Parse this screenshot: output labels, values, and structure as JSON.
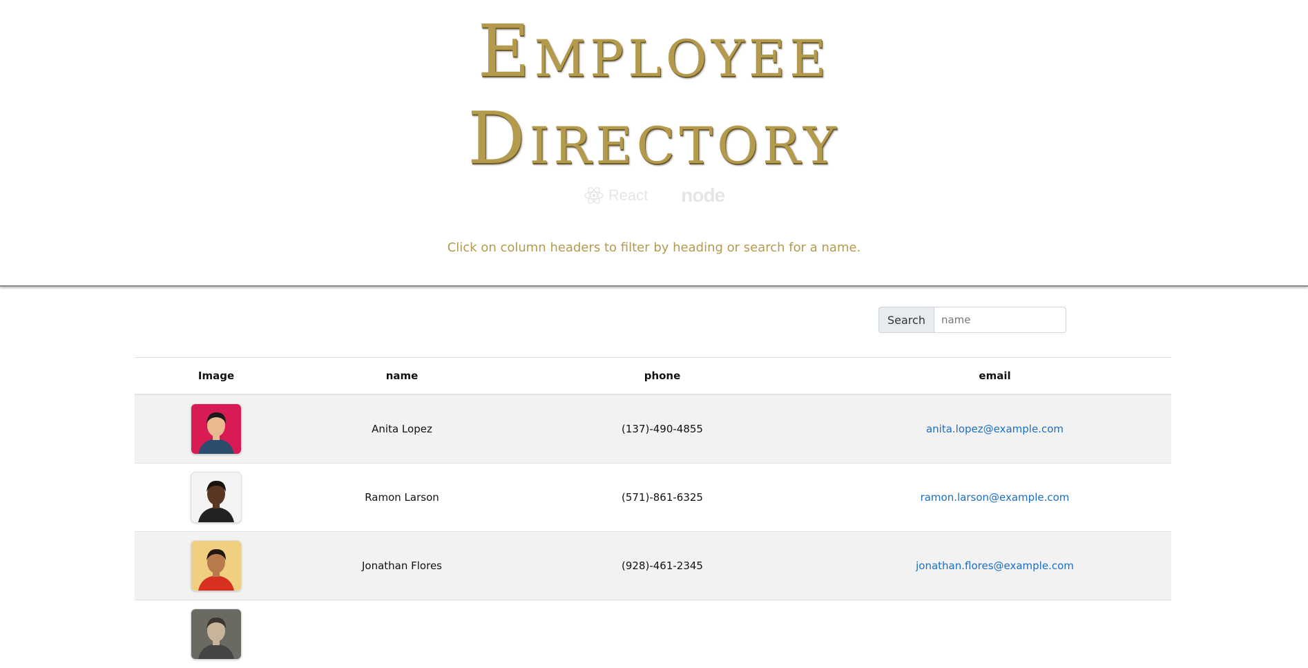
{
  "header": {
    "title_line1": "Employee",
    "title_line2": "Directory",
    "tech_react": "React",
    "tech_node": "node",
    "subtitle": "Click on column headers to filter by heading or search for a name."
  },
  "search": {
    "label": "Search",
    "placeholder": "name",
    "value": ""
  },
  "table": {
    "headers": {
      "image": "Image",
      "name": "name",
      "phone": "phone",
      "email": "email"
    },
    "rows": [
      {
        "name": "Anita Lopez",
        "phone": "(137)-490-4855",
        "email": "anita.lopez@example.com",
        "avatar_bg": "#d81b55",
        "avatar_skin": "#e9b98f",
        "avatar_hair": "#1b1b1b",
        "avatar_shirt": "#2a4d6e"
      },
      {
        "name": "Ramon Larson",
        "phone": "(571)-861-6325",
        "email": "ramon.larson@example.com",
        "avatar_bg": "#f4f4f4",
        "avatar_skin": "#5a3722",
        "avatar_hair": "#1a120c",
        "avatar_shirt": "#222222"
      },
      {
        "name": "Jonathan Flores",
        "phone": "(928)-461-2345",
        "email": "jonathan.flores@example.com",
        "avatar_bg": "#f0d080",
        "avatar_skin": "#b97a4c",
        "avatar_hair": "#221810",
        "avatar_shirt": "#d8301f"
      },
      {
        "name": "",
        "phone": "",
        "email": "",
        "avatar_bg": "#6b6a62",
        "avatar_skin": "#c8b49a",
        "avatar_hair": "#3a3530",
        "avatar_shirt": "#444444"
      }
    ]
  },
  "colors": {
    "title_gold": "#b39a4c",
    "link_blue": "#1a6fc4",
    "striped_row": "#f2f2f2"
  }
}
